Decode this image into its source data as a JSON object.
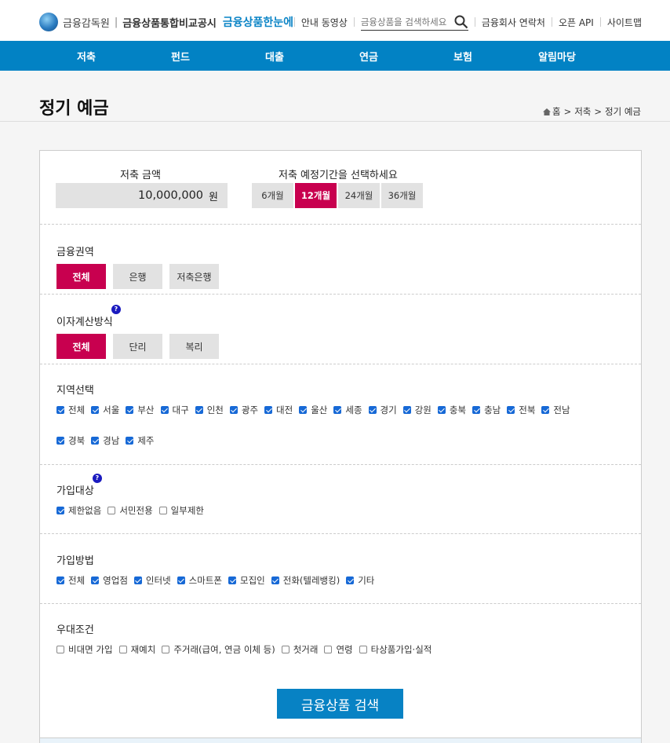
{
  "header": {
    "org1": "금융감독원",
    "org2": "금융상품통합비교공시",
    "brand": "금융상품한눈에",
    "links": [
      "안내 동영상",
      "금융회사 연락처",
      "오픈 API",
      "사이트맵"
    ],
    "search_placeholder": "금융상품을 검색하세요"
  },
  "nav": [
    "저축",
    "펀드",
    "대출",
    "연금",
    "보험",
    "알림마당"
  ],
  "page": {
    "title": "정기 예금",
    "breadcrumb": [
      "홈",
      "저축",
      "정기 예금"
    ]
  },
  "amount": {
    "label": "저축 금액",
    "value": "10,000,000",
    "unit": "원"
  },
  "period": {
    "label": "저축 예정기간을 선택하세요",
    "options": [
      "6개월",
      "12개월",
      "24개월",
      "36개월"
    ],
    "selected": "12개월"
  },
  "sector": {
    "label": "금융권역",
    "options": [
      "전체",
      "은행",
      "저축은행"
    ],
    "selected": "전체"
  },
  "interest": {
    "label": "이자계산방식",
    "help": "?",
    "options": [
      "전체",
      "단리",
      "복리"
    ],
    "selected": "전체"
  },
  "region": {
    "label": "지역선택",
    "items": [
      {
        "t": "전체",
        "c": true
      },
      {
        "t": "서울",
        "c": true
      },
      {
        "t": "부산",
        "c": true
      },
      {
        "t": "대구",
        "c": true
      },
      {
        "t": "인천",
        "c": true
      },
      {
        "t": "광주",
        "c": true
      },
      {
        "t": "대전",
        "c": true
      },
      {
        "t": "울산",
        "c": true
      },
      {
        "t": "세종",
        "c": true
      },
      {
        "t": "경기",
        "c": true
      },
      {
        "t": "강원",
        "c": true
      },
      {
        "t": "충북",
        "c": true
      },
      {
        "t": "충남",
        "c": true
      },
      {
        "t": "전북",
        "c": true
      },
      {
        "t": "전남",
        "c": true
      },
      {
        "t": "경북",
        "c": true
      },
      {
        "t": "경남",
        "c": true
      },
      {
        "t": "제주",
        "c": true
      }
    ]
  },
  "target": {
    "label": "가입대상",
    "help": "?",
    "items": [
      {
        "t": "제한없음",
        "c": true
      },
      {
        "t": "서민전용",
        "c": false
      },
      {
        "t": "일부제한",
        "c": false
      }
    ]
  },
  "method": {
    "label": "가입방법",
    "items": [
      {
        "t": "전체",
        "c": true
      },
      {
        "t": "영업점",
        "c": true
      },
      {
        "t": "인터넷",
        "c": true
      },
      {
        "t": "스마트폰",
        "c": true
      },
      {
        "t": "모집인",
        "c": true
      },
      {
        "t": "전화(텔레뱅킹)",
        "c": true
      },
      {
        "t": "기타",
        "c": true
      }
    ]
  },
  "benefit": {
    "label": "우대조건",
    "items": [
      {
        "t": "비대면 가입",
        "c": false
      },
      {
        "t": "재예치",
        "c": false
      },
      {
        "t": "주거래(급여, 연금 이체 등)",
        "c": false
      },
      {
        "t": "첫거래",
        "c": false
      },
      {
        "t": "연령",
        "c": false
      },
      {
        "t": "타상품가입·실적",
        "c": false
      }
    ]
  },
  "search_button": "금융상품 검색",
  "colors": {
    "primary": "#0282c4",
    "accent": "#c8004f"
  }
}
